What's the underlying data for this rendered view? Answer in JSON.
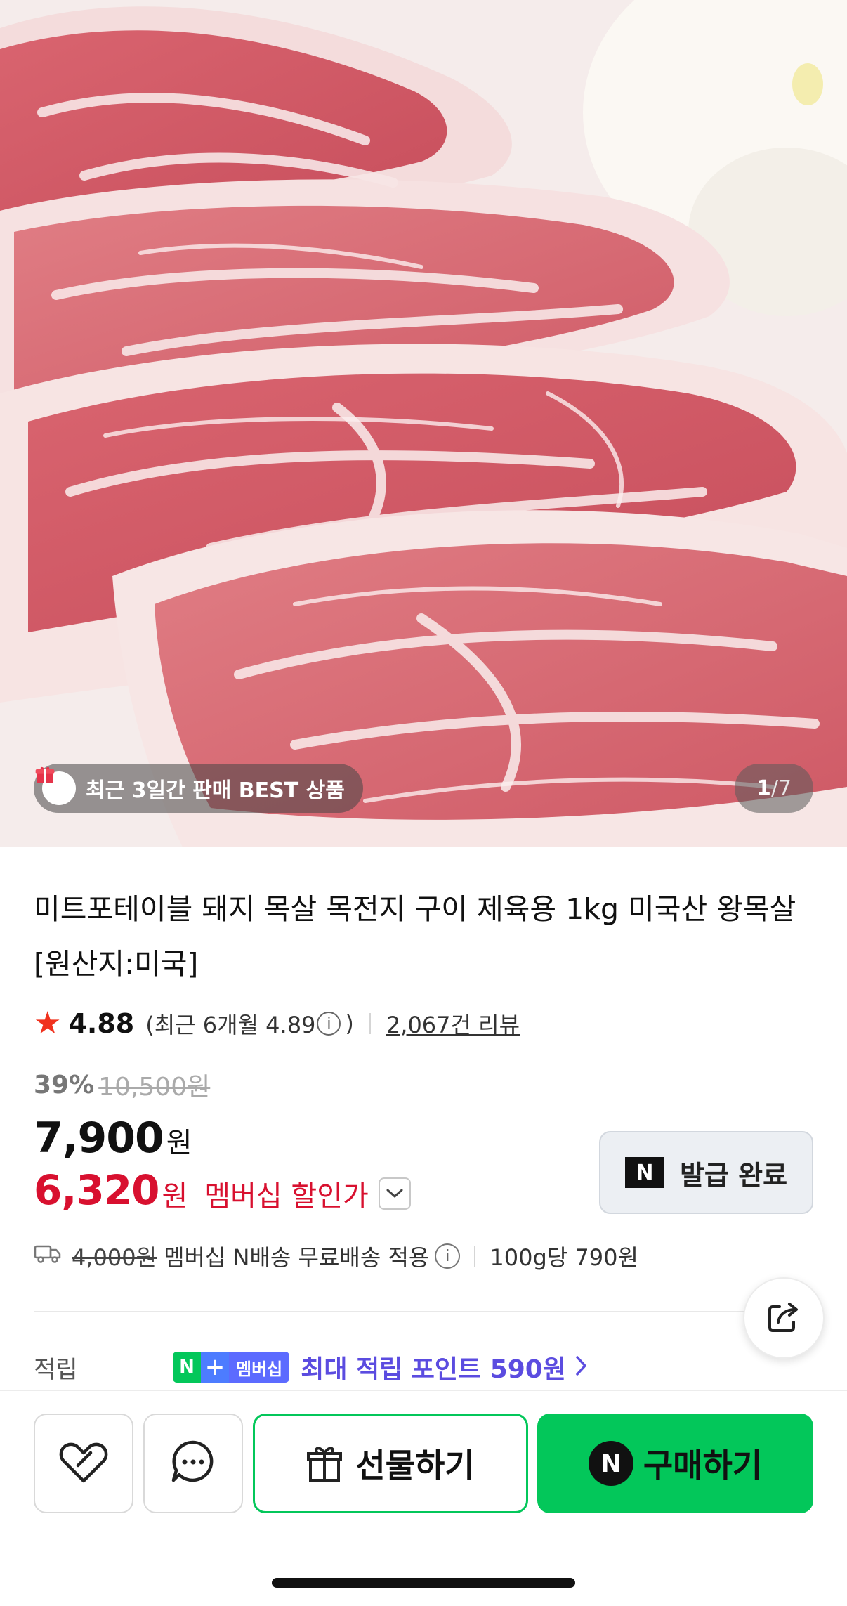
{
  "hero": {
    "best_badge": "최근 3일간 판매 BEST 상품",
    "page_current": "1",
    "page_total": "/7"
  },
  "product": {
    "title": "미트포테이블 돼지 목살 목전지 구이 제육용 1kg 미국산 왕목살 [원산지:미국]",
    "rating": "4.88",
    "recent_rating_prefix": "(최근 6개월 4.89",
    "recent_rating_suffix": ")",
    "review_count": "2,067건 리뷰",
    "discount_rate": "39%",
    "original_price": "10,500원",
    "sale_price": "7,900",
    "price_unit": "원",
    "member_price": "6,320",
    "member_price_unit": "원",
    "member_price_label": "멤버십 할인가"
  },
  "coupon": {
    "n_label": "N",
    "label": "발급 완료"
  },
  "shipping": {
    "original_fee": "4,000원",
    "text": "멤버십 N배송 무료배송 적용",
    "unit_price": "100g당 790원"
  },
  "points": {
    "label": "적립",
    "badge_n": "N",
    "badge_plus": "+",
    "badge_member": "멤버십",
    "text": "최대 적립 포인트 590원"
  },
  "actions": {
    "gift_label": "선물하기",
    "buy_n": "N",
    "buy_label": "구매하기"
  },
  "colors": {
    "naver_green": "#03c75a",
    "member_red": "#d8102f",
    "points_purple": "#5b4ce0",
    "star": "#f0321e"
  }
}
